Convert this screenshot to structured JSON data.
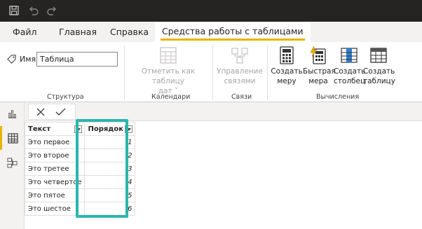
{
  "titlebar": {
    "icons": [
      "save-icon",
      "undo-icon",
      "redo-icon"
    ]
  },
  "tabs": [
    {
      "label": "Файл"
    },
    {
      "label": "Главная"
    },
    {
      "label": "Справка"
    },
    {
      "label": "Средства работы с таблицами",
      "active": true
    }
  ],
  "ribbon": {
    "structure": {
      "name_label": "Имя",
      "name_value": "Таблица",
      "group_label": "Структура"
    },
    "calendars": {
      "mark_line1": "Отметить как таблицу",
      "mark_line2": "дат",
      "group_label": "Календари"
    },
    "relations": {
      "manage_line1": "Управление",
      "manage_line2": "связями",
      "group_label": "Связи"
    },
    "calc": {
      "new_measure_1": "Создать",
      "new_measure_2": "меру",
      "quick_measure_1": "Быстрая",
      "quick_measure_2": "мера",
      "new_column_1": "Создать",
      "new_column_2": "столбец",
      "new_table_1": "Создать",
      "new_table_2": "таблицу",
      "group_label": "Вычисления"
    }
  },
  "table": {
    "headers": [
      "Текст",
      "Порядок"
    ],
    "rows": [
      {
        "text": "Это первое",
        "order": "1"
      },
      {
        "text": "Это второе",
        "order": "2"
      },
      {
        "text": "Это третее",
        "order": "3"
      },
      {
        "text": "Это четвертое",
        "order": "4"
      },
      {
        "text": "Это пятое",
        "order": "5"
      },
      {
        "text": "Это шестое",
        "order": "6"
      }
    ]
  },
  "colors": {
    "accent": "#e8b300",
    "highlight": "#2bb6ac",
    "titlebar": "#252423"
  }
}
